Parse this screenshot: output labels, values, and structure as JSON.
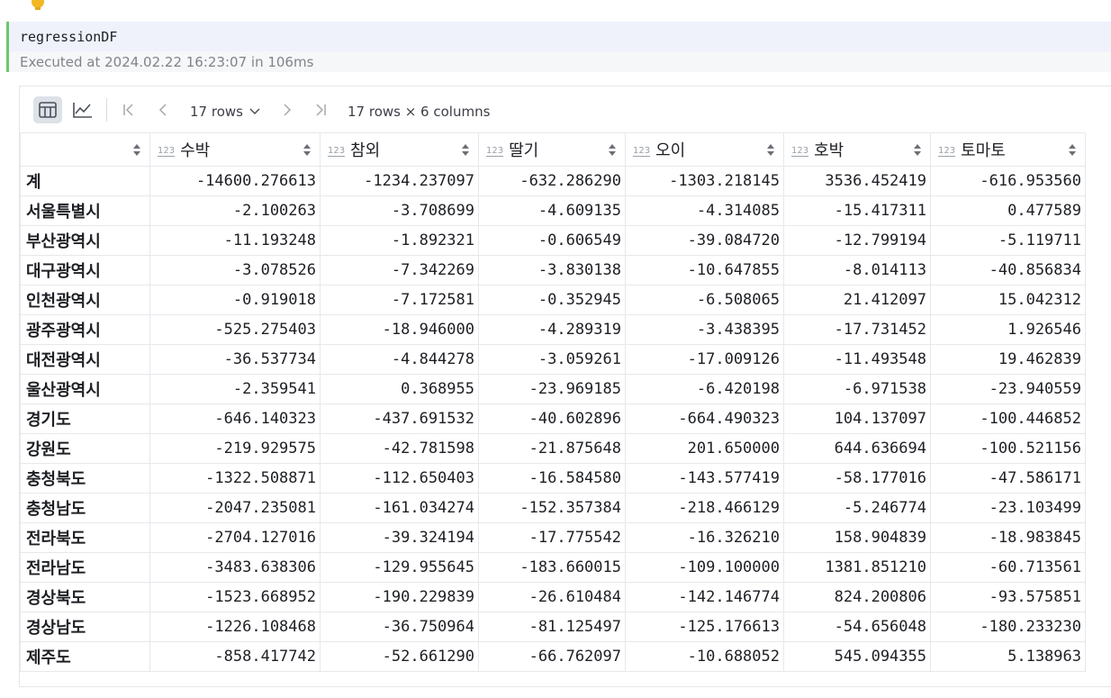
{
  "cell": {
    "code": "regressionDF",
    "execution_info": "Executed at 2024.02.22 16:23:07 in 106ms"
  },
  "toolbar": {
    "table_view_icon": "table-icon",
    "chart_view_icon": "chart-icon",
    "rows_dropdown": "17 rows",
    "summary": "17 rows × 6 columns"
  },
  "table": {
    "type_badge": "123",
    "columns": [
      "수박",
      "참외",
      "딸기",
      "오이",
      "호박",
      "토마토"
    ],
    "rows": [
      {
        "index": "계",
        "values": [
          "-14600.276613",
          "-1234.237097",
          "-632.286290",
          "-1303.218145",
          "3536.452419",
          "-616.953560"
        ]
      },
      {
        "index": "서울특별시",
        "values": [
          "-2.100263",
          "-3.708699",
          "-4.609135",
          "-4.314085",
          "-15.417311",
          "0.477589"
        ]
      },
      {
        "index": "부산광역시",
        "values": [
          "-11.193248",
          "-1.892321",
          "-0.606549",
          "-39.084720",
          "-12.799194",
          "-5.119711"
        ]
      },
      {
        "index": "대구광역시",
        "values": [
          "-3.078526",
          "-7.342269",
          "-3.830138",
          "-10.647855",
          "-8.014113",
          "-40.856834"
        ]
      },
      {
        "index": "인천광역시",
        "values": [
          "-0.919018",
          "-7.172581",
          "-0.352945",
          "-6.508065",
          "21.412097",
          "15.042312"
        ]
      },
      {
        "index": "광주광역시",
        "values": [
          "-525.275403",
          "-18.946000",
          "-4.289319",
          "-3.438395",
          "-17.731452",
          "1.926546"
        ]
      },
      {
        "index": "대전광역시",
        "values": [
          "-36.537734",
          "-4.844278",
          "-3.059261",
          "-17.009126",
          "-11.493548",
          "19.462839"
        ]
      },
      {
        "index": "울산광역시",
        "values": [
          "-2.359541",
          "0.368955",
          "-23.969185",
          "-6.420198",
          "-6.971538",
          "-23.940559"
        ]
      },
      {
        "index": "경기도",
        "values": [
          "-646.140323",
          "-437.691532",
          "-40.602896",
          "-664.490323",
          "104.137097",
          "-100.446852"
        ]
      },
      {
        "index": "강원도",
        "values": [
          "-219.929575",
          "-42.781598",
          "-21.875648",
          "201.650000",
          "644.636694",
          "-100.521156"
        ]
      },
      {
        "index": "충청북도",
        "values": [
          "-1322.508871",
          "-112.650403",
          "-16.584580",
          "-143.577419",
          "-58.177016",
          "-47.586171"
        ]
      },
      {
        "index": "충청남도",
        "values": [
          "-2047.235081",
          "-161.034274",
          "-152.357384",
          "-218.466129",
          "-5.246774",
          "-23.103499"
        ]
      },
      {
        "index": "전라북도",
        "values": [
          "-2704.127016",
          "-39.324194",
          "-17.775542",
          "-16.326210",
          "158.904839",
          "-18.983845"
        ]
      },
      {
        "index": "전라남도",
        "values": [
          "-3483.638306",
          "-129.955645",
          "-183.660015",
          "-109.100000",
          "1381.851210",
          "-60.713561"
        ]
      },
      {
        "index": "경상북도",
        "values": [
          "-1523.668952",
          "-190.229839",
          "-26.610484",
          "-142.146774",
          "824.200806",
          "-93.575851"
        ]
      },
      {
        "index": "경상남도",
        "values": [
          "-1226.108468",
          "-36.750964",
          "-81.125497",
          "-125.176613",
          "-54.656048",
          "-180.233230"
        ]
      },
      {
        "index": "제주도",
        "values": [
          "-858.417742",
          "-52.661290",
          "-66.762097",
          "-10.688052",
          "545.094355",
          "5.138963"
        ]
      }
    ]
  },
  "colors": {
    "accent_bar": "#6ec76a",
    "bulb": "#f2b824"
  }
}
